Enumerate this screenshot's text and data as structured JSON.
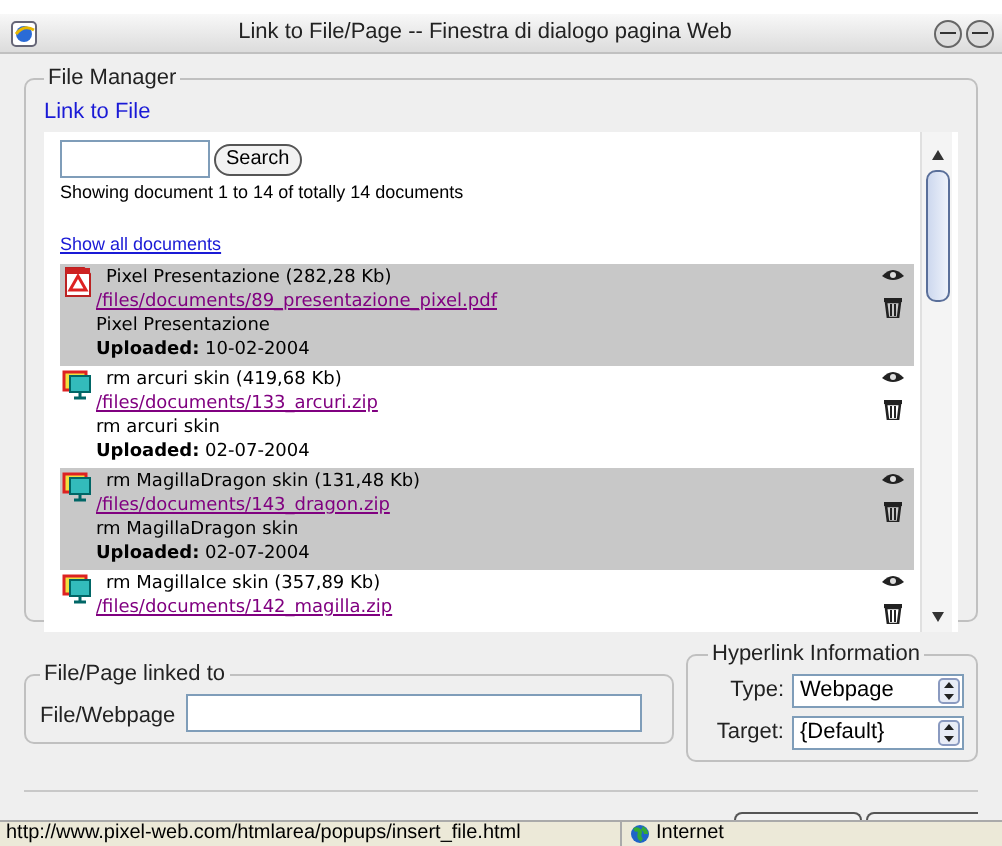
{
  "window": {
    "title": "Link to File/Page -- Finestra di dialogo pagina Web"
  },
  "file_manager": {
    "legend": "File Manager",
    "link": "Link to File",
    "search": {
      "button": "Search"
    },
    "summary": "Showing document 1 to 14 of totally 14 documents",
    "show_all": "Show all documents",
    "documents": [
      {
        "kind": "pdf",
        "title": "Pixel Presentazione (282,28 Kb)",
        "path": "/files/documents/89_presentazione_pixel.pdf",
        "description": "Pixel Presentazione",
        "uploaded_label": "Uploaded:",
        "uploaded": "10-02-2004"
      },
      {
        "kind": "zip",
        "title": "rm arcuri skin (419,68 Kb)",
        "path": "/files/documents/133_arcuri.zip",
        "description": "rm arcuri skin",
        "uploaded_label": "Uploaded:",
        "uploaded": "02-07-2004"
      },
      {
        "kind": "zip",
        "title": "rm MagillaDragon skin (131,48 Kb)",
        "path": "/files/documents/143_dragon.zip",
        "description": "rm MagillaDragon skin",
        "uploaded_label": "Uploaded:",
        "uploaded": "02-07-2004"
      },
      {
        "kind": "zip",
        "title": "rm MagillaIce skin (357,89 Kb)",
        "path": "/files/documents/142_magilla.zip"
      }
    ]
  },
  "linked": {
    "legend": "File/Page linked to",
    "label": "File/Webpage"
  },
  "hyperlink": {
    "legend": "Hyperlink Information",
    "fields": [
      {
        "label": "Type:",
        "value": "Webpage"
      },
      {
        "label": "Target:",
        "value": "{Default}"
      }
    ]
  },
  "status_bar": {
    "url": "http://www.pixel-web.com/htmlarea/popups/insert_file.html",
    "zone": "Internet"
  }
}
